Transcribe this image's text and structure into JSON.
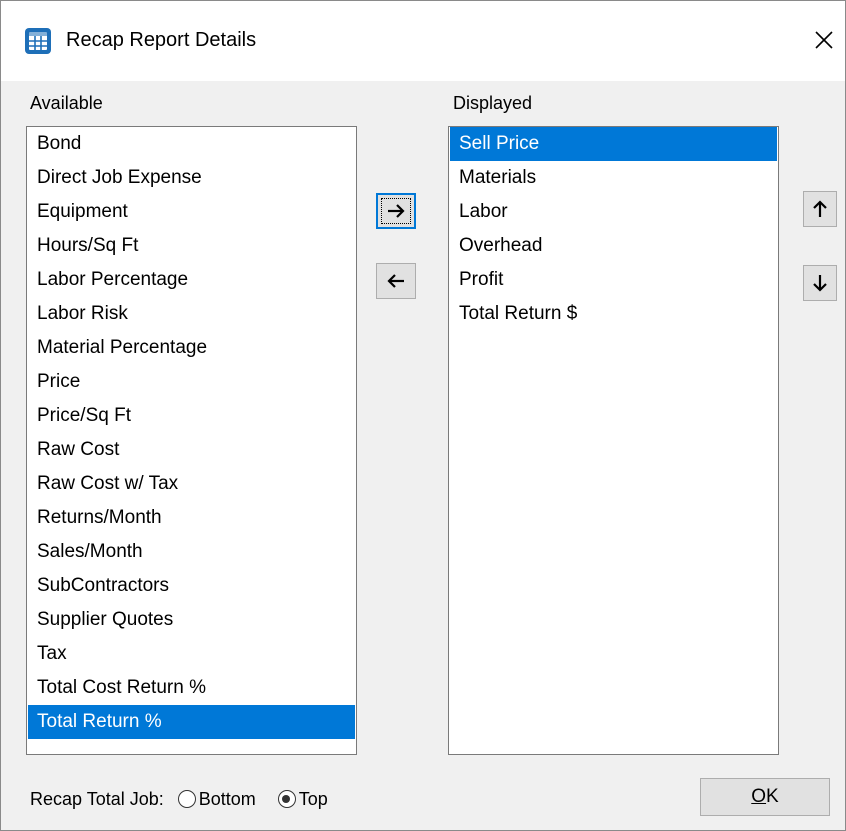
{
  "window": {
    "title": "Recap Report Details"
  },
  "available": {
    "label": "Available",
    "items": [
      "Bond",
      "Direct Job Expense",
      "Equipment",
      "Hours/Sq Ft",
      "Labor Percentage",
      "Labor Risk",
      "Material Percentage",
      "Price",
      "Price/Sq Ft",
      "Raw Cost",
      "Raw Cost w/ Tax",
      "Returns/Month",
      "Sales/Month",
      "SubContractors",
      "Supplier Quotes",
      "Tax",
      "Total Cost Return %",
      "Total Return %"
    ],
    "selected": "Total Return %"
  },
  "displayed": {
    "label": "Displayed",
    "items": [
      "Sell Price",
      "Materials",
      "Labor",
      "Overhead",
      "Profit",
      "Total Return $"
    ],
    "selected": "Sell Price"
  },
  "buttons": {
    "add_icon": "arrow-right-icon",
    "remove_icon": "arrow-left-icon",
    "move_up_icon": "arrow-up-icon",
    "move_down_icon": "arrow-down-icon",
    "ok_label_mnemonic": "O",
    "ok_label_rest": "K"
  },
  "recap_total_job": {
    "label": "Recap Total Job:",
    "options": [
      "Bottom",
      "Top"
    ],
    "selected": "Top"
  },
  "colors": {
    "selection": "#0078d7",
    "app_icon": "#1e6fb8"
  }
}
